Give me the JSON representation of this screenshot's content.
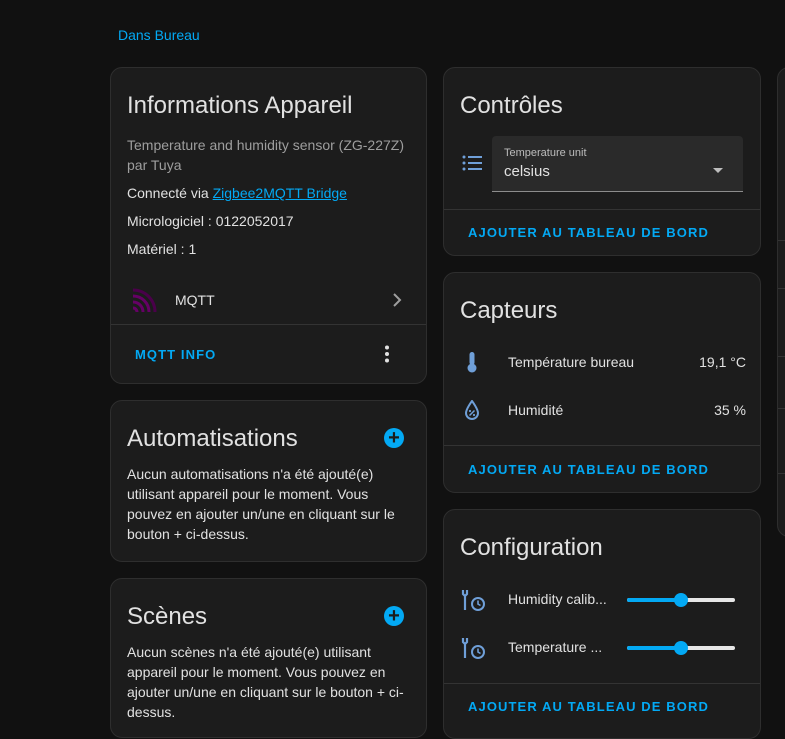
{
  "area_link": "Dans Bureau",
  "device_info": {
    "title": "Informations Appareil",
    "model": "Temperature and humidity sensor (ZG-227Z)",
    "manufacturer": "par Tuya",
    "connected_prefix": "Connecté via ",
    "connected_link": "Zigbee2MQTT Bridge",
    "firmware": "Micrologiciel : 0122052017",
    "hardware": "Matériel : 1",
    "integration": "MQTT",
    "action": "MQTT INFO"
  },
  "automations": {
    "title": "Automatisations",
    "empty_text": "Aucun automatisations n'a été ajouté(e) utilisant appareil pour le moment. Vous pouvez en ajouter un/une en cliquant sur le bouton + ci-dessus."
  },
  "scenes": {
    "title": "Scènes",
    "empty_text": "Aucun scènes n'a été ajouté(e) utilisant appareil pour le moment. Vous pouvez en ajouter un/une en cliquant sur le bouton + ci-dessus."
  },
  "controls": {
    "title": "Contrôles",
    "select_label": "Temperature unit",
    "select_value": "celsius",
    "action": "AJOUTER AU TABLEAU DE BORD"
  },
  "sensors": {
    "title": "Capteurs",
    "items": [
      {
        "name": "Température bureau",
        "value": "19,1 °C"
      },
      {
        "name": "Humidité",
        "value": "35 %"
      }
    ],
    "action": "AJOUTER AU TABLEAU DE BORD"
  },
  "configuration": {
    "title": "Configuration",
    "items": [
      {
        "name": "Humidity calib...",
        "level": 0.5
      },
      {
        "name": "Temperature ...",
        "level": 0.5
      }
    ],
    "action": "AJOUTER AU TABLEAU DE BORD"
  },
  "colors": {
    "accent": "#03a9f4",
    "icon_blue": "#6f9fd8",
    "mqtt_purple": "#660066",
    "card_bg": "#1c1c1c",
    "page_bg": "#111111"
  }
}
